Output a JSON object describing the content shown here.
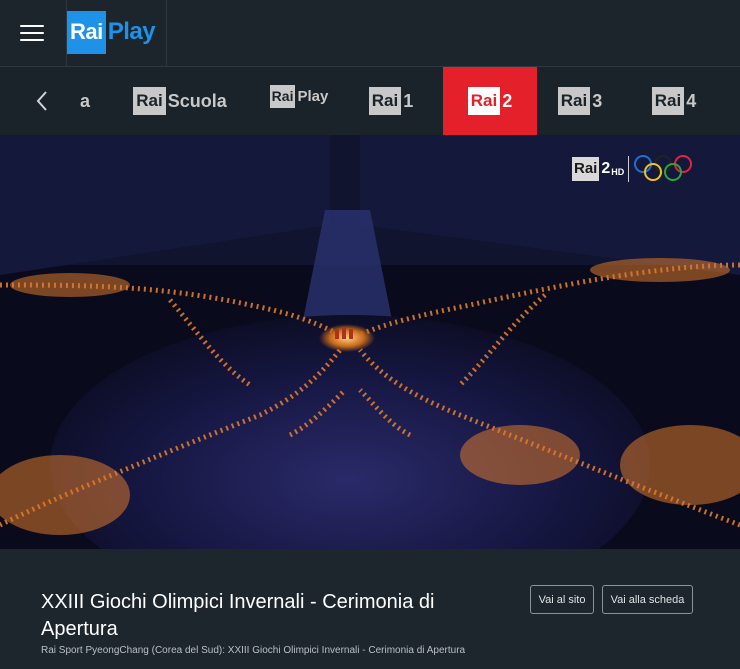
{
  "header": {
    "menu_icon": "hamburger-menu-icon",
    "logo": {
      "rai": "Rai",
      "play": "Play"
    }
  },
  "channels": {
    "prev_icon": "chevron-left-icon",
    "items": [
      {
        "box": "",
        "text": "a",
        "selected": false
      },
      {
        "box": "Rai",
        "text": "Scuola",
        "selected": false
      },
      {
        "box": "Rai",
        "text": "Play",
        "selected": false
      },
      {
        "box": "Rai",
        "text": "1",
        "selected": false
      },
      {
        "box": "Rai",
        "text": "2",
        "selected": true
      },
      {
        "box": "Rai",
        "text": "3",
        "selected": false
      },
      {
        "box": "Rai",
        "text": "4",
        "selected": false
      }
    ]
  },
  "player": {
    "channel_bug": {
      "box": "Rai",
      "num": "2",
      "hd": "HD"
    },
    "olympic_rings_icon": "olympic-rings-icon"
  },
  "program": {
    "title": "XXIII Giochi Olimpici Invernali - Cerimonia di Apertura",
    "subtitle": "Rai Sport PyeongChang (Corea del Sud): XXIII Giochi Olimpici Invernali - Cerimonia di Apertura",
    "buttons": {
      "site": "Vai al sito",
      "scheda": "Vai alla scheda"
    }
  },
  "colors": {
    "accent_rai2": "#e4212a",
    "rai_blue": "#1e92e8",
    "background": "#1a2329"
  }
}
